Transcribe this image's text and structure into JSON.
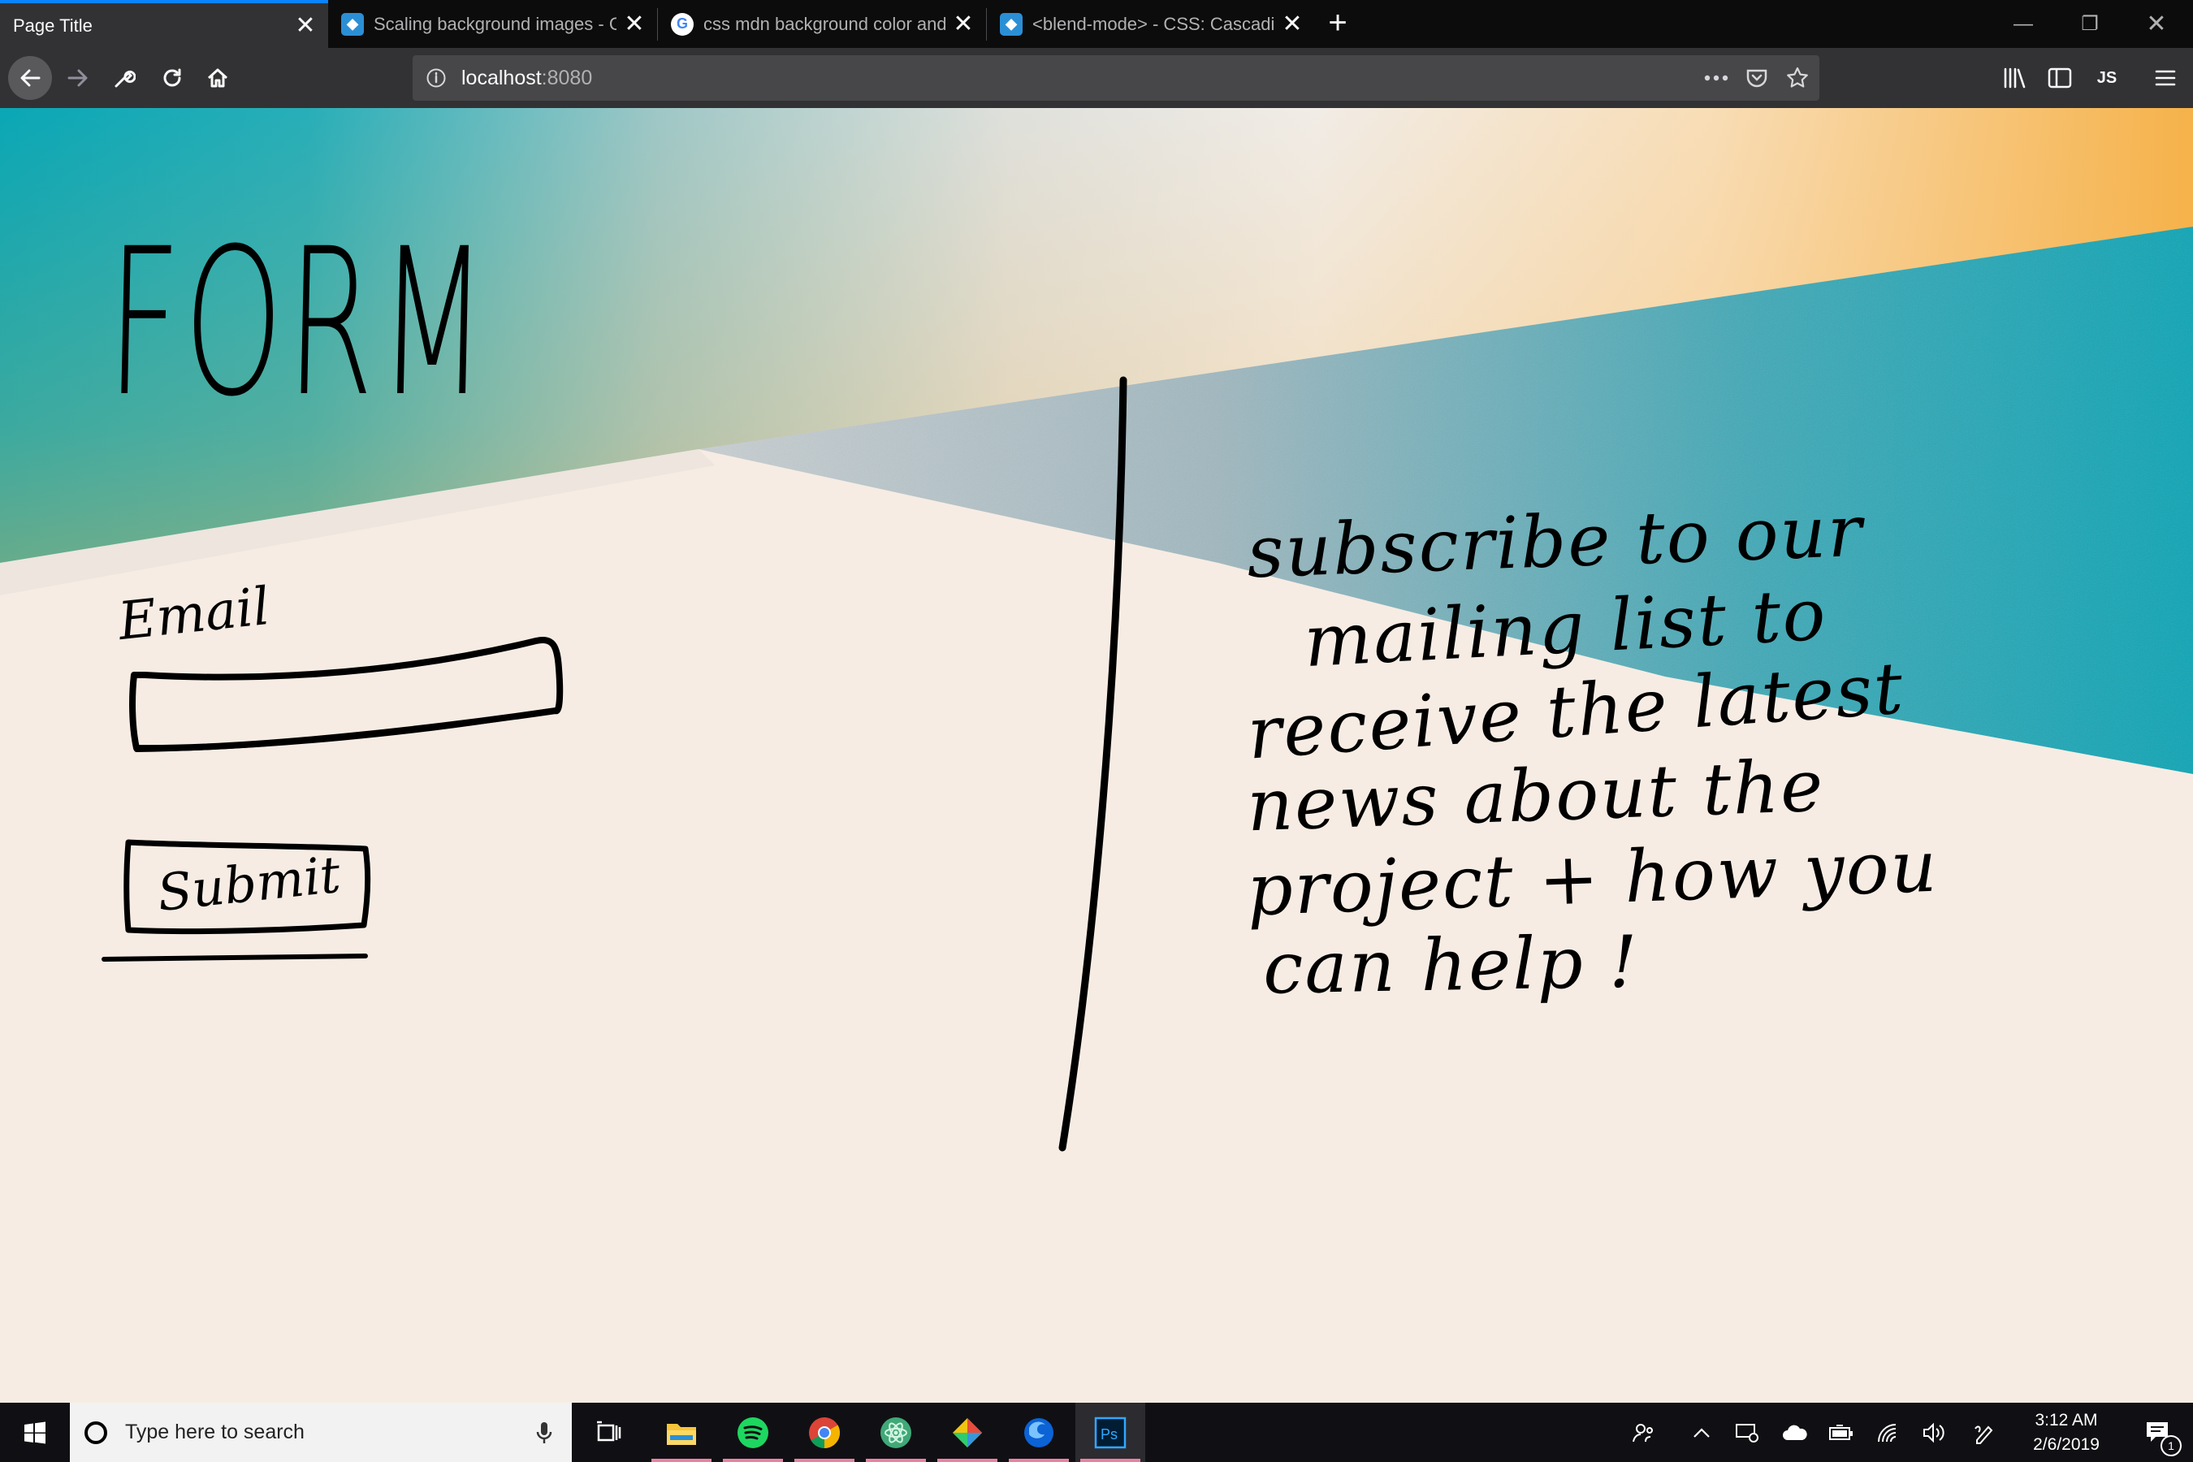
{
  "browser": {
    "tabs": [
      {
        "title": "Page Title",
        "icon": "none",
        "active": true
      },
      {
        "title": "Scaling background images - C",
        "icon": "mdn-icon",
        "active": false
      },
      {
        "title": "css mdn background color and",
        "icon": "google-icon",
        "active": false
      },
      {
        "title": "<blend-mode> - CSS: Cascadin",
        "icon": "mdn-icon",
        "active": false
      }
    ],
    "url_host": "localhost",
    "url_port": ":8080"
  },
  "sketch": {
    "heading": "FORM",
    "email_label": "Email",
    "submit_label": "Submit",
    "subscribe_lines": [
      "subscribe to our",
      "mailing list to",
      "receive the latest",
      "news about the",
      "project + how you",
      "can help !"
    ]
  },
  "taskbar": {
    "search_placeholder": "Type here to search",
    "time": "3:12 AM",
    "date": "2/6/2019",
    "notification_count": "1"
  },
  "colors": {
    "teal": "#0aa7b6",
    "orange": "#f6b24a",
    "cream": "#f6ece3",
    "ink": "#000000"
  }
}
